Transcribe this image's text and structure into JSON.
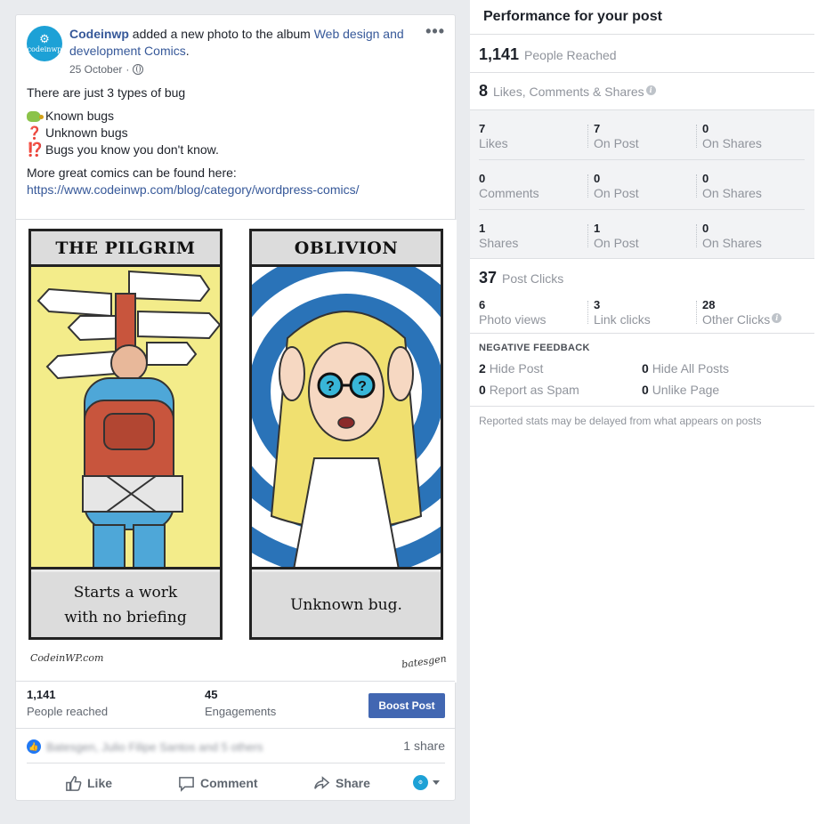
{
  "post": {
    "author": "Codeinwp",
    "avatar_text": "codeinwp",
    "action_text": " added a new photo to the album ",
    "album": "Web design and development Comics",
    "album_suffix": ".",
    "date": "25 October",
    "date_sep": "·",
    "more_menu": "•••",
    "body": {
      "intro": "There are just 3 types of bug",
      "item1": "Known bugs",
      "item2": "Unknown bugs",
      "item3": "Bugs you know you don't know.",
      "emoji2": "❓",
      "emoji3": "⁉️",
      "more_text": "More great comics can be found here:",
      "link": "https://www.codeinwp.com/blog/category/wordpress-comics/"
    },
    "comic": {
      "left_title": "THE PILGRIM",
      "left_caption": "Starts a work with no briefing",
      "right_title": "OBLIVION",
      "right_caption": "Unknown bug.",
      "sig_left": "CodeinWP.com",
      "sig_right": "batesgen"
    },
    "reach": {
      "people_reached_value": "1,141",
      "people_reached_label": "People reached",
      "engagements_value": "45",
      "engagements_label": "Engagements",
      "boost_label": "Boost Post"
    },
    "reactions": {
      "names": "Batesgen, Julio Filipe Santos and 5 others",
      "shares": "1 share",
      "like_icon": "👍"
    },
    "actions": {
      "like": "Like",
      "comment": "Comment",
      "share": "Share"
    }
  },
  "performance": {
    "title": "Performance for your post",
    "people_reached_value": "1,141",
    "people_reached_label": "People Reached",
    "engagement_value": "8",
    "engagement_label": "Likes, Comments & Shares",
    "info_glyph": "i",
    "rows": [
      {
        "c1n": "7",
        "c1l": "Likes",
        "c2n": "7",
        "c2l": "On Post",
        "c3n": "0",
        "c3l": "On Shares"
      },
      {
        "c1n": "0",
        "c1l": "Comments",
        "c2n": "0",
        "c2l": "On Post",
        "c3n": "0",
        "c3l": "On Shares"
      },
      {
        "c1n": "1",
        "c1l": "Shares",
        "c2n": "1",
        "c2l": "On Post",
        "c3n": "0",
        "c3l": "On Shares"
      }
    ],
    "post_clicks_value": "37",
    "post_clicks_label": "Post Clicks",
    "clicks": {
      "photo_n": "6",
      "photo_l": "Photo views",
      "link_n": "3",
      "link_l": "Link clicks",
      "other_n": "28",
      "other_l": "Other Clicks"
    },
    "negative_title": "NEGATIVE FEEDBACK",
    "negative": {
      "hide_post_n": "2",
      "hide_post_l": "Hide Post",
      "hide_all_n": "0",
      "hide_all_l": "Hide All Posts",
      "spam_n": "0",
      "spam_l": "Report as Spam",
      "unlike_n": "0",
      "unlike_l": "Unlike Page"
    },
    "footnote": "Reported stats may be delayed from what appears on posts"
  },
  "colors": {
    "link": "#365899",
    "boost": "#4267b2",
    "muted": "#90949c"
  }
}
